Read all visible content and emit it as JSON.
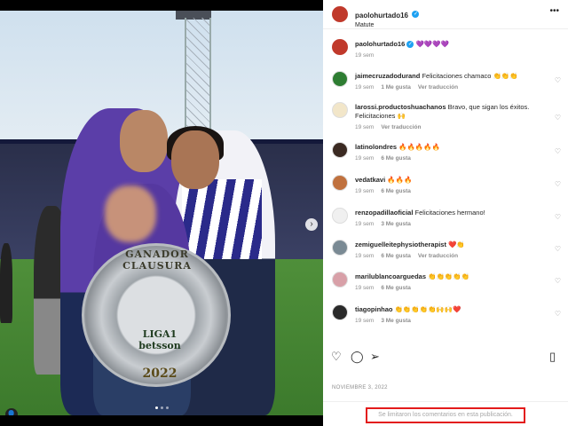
{
  "post": {
    "photo": {
      "trophy_top_text": "GANADOR CLAUSURA",
      "trophy_mid_text": "LIGA1 betsson",
      "trophy_year": "2022"
    }
  },
  "header": {
    "username": "paolohurtado16",
    "location": "Matute"
  },
  "caption": {
    "username": "paolohurtado16",
    "text": "💜💜💜💜",
    "time": "19 sem"
  },
  "comments": [
    {
      "username": "jaimecruzadodurand",
      "text": "Felicitaciones chamaco 👏👏👏",
      "time": "19 sem",
      "likes": "1 Me gusta",
      "reply": "Ver traducción",
      "avatar_color": "#2e7d32"
    },
    {
      "username": "larossi.productoshuachanos",
      "text": "Bravo, que sigan los éxitos. Felicitaciones 🙌",
      "time": "19 sem",
      "likes": "",
      "reply": "Ver traducción",
      "avatar_color": "#f2e6c9"
    },
    {
      "username": "latinolondres",
      "text": "🔥🔥🔥🔥🔥",
      "time": "19 sem",
      "likes": "6 Me gusta",
      "reply": "",
      "avatar_color": "#3b2a22"
    },
    {
      "username": "vedatkavi",
      "text": "🔥🔥🔥",
      "time": "19 sem",
      "likes": "6 Me gusta",
      "reply": "",
      "avatar_color": "#c0713e"
    },
    {
      "username": "renzopadillaoficial",
      "text": "Felicitaciones hermano!",
      "time": "19 sem",
      "likes": "3 Me gusta",
      "reply": "",
      "avatar_color": "#f0f0f0"
    },
    {
      "username": "zemiguelleitephysiotherapist",
      "text": "❤️👏",
      "time": "19 sem",
      "likes": "6 Me gusta",
      "reply": "Ver traducción",
      "avatar_color": "#7a8a94"
    },
    {
      "username": "marilublancoarguedas",
      "text": "👏👏👏👏👏",
      "time": "19 sem",
      "likes": "6 Me gusta",
      "reply": "",
      "avatar_color": "#d8a0a8"
    },
    {
      "username": "tiagopinhao",
      "text": "👏👏👏👏👏🙌🙌❤️",
      "time": "19 sem",
      "likes": "3 Me gusta",
      "reply": "",
      "avatar_color": "#2a2a2a"
    }
  ],
  "main_labels": {
    "date": "NOVIEMBRE 3, 2022",
    "comments_limited": "Se limitaron los comentarios en esta publicación."
  },
  "icons": {
    "like": "heart-icon",
    "comment": "comment-icon",
    "share": "share-icon",
    "save": "bookmark-icon",
    "more": "more-icon"
  },
  "colors": {
    "verified": "#1da1f2",
    "highlight_border": "#e31b1b"
  }
}
